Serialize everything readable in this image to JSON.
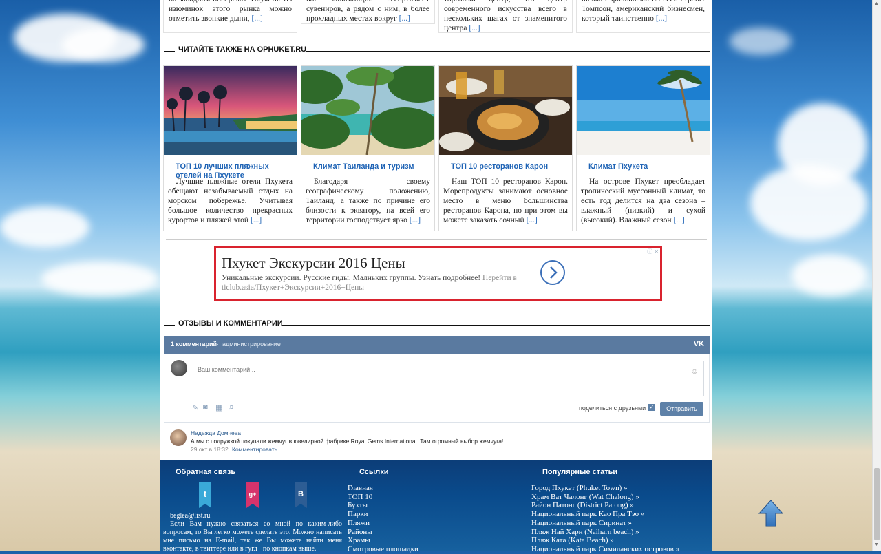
{
  "top_cards": [
    {
      "text": "на западном побережье Пхукета. Из изюминок этого рынка можно отметить звонкие дыни,",
      "more": "[...]"
    },
    {
      "text": "вне кальмбиции ассортимент сувениров, а рядом с ним, в более прохладных местах вокруг",
      "more": "[...]"
    },
    {
      "text": "торговый центр, это центр современного искусства всего в нескольких шагах от знаменитого центра",
      "more": "[...]"
    },
    {
      "text": "шелка с филиалами по всей стране. Томпсон, американский бизнесмен, который таинственно",
      "more": "[...]"
    }
  ],
  "read_also": {
    "heading": "ЧИТАЙТЕ ТАКЖЕ НА OPHUKET.RU",
    "cards": [
      {
        "title": "ТОП 10 лучших пляжных отелей на Пхукете",
        "text": "Лучшие пляжные отели Пхукета обещают незабываемый отдых на морском побережье. Учитывая большое количество прекрасных курортов и пляжей этой",
        "more": "[...]"
      },
      {
        "title": "Климат Таиланда и туризм",
        "text": "Благодаря своему географическому положению, Таиланд, а также по причине его близости к экватору, на всей его территории господствует ярко",
        "more": "[...]"
      },
      {
        "title": "ТОП 10 ресторанов Карон",
        "text": "Наш ТОП 10 ресторанов Карон. Морепродукты занимают основное место в меню большинства ресторанов Карона, но при этом вы можете заказать сочный",
        "more": "[...]"
      },
      {
        "title": "Климат Пхукета",
        "text": "На острове Пхукет преобладает тропический муссонный климат, то есть год делится на два сезона – влажный (низкий) и сухой (высокий). Влажный сезон",
        "more": "[...]"
      }
    ]
  },
  "ad": {
    "title": "Пхукет Экскурсии 2016 Цены",
    "text": "Уникальные экскурсии. Русские гиды. Малньких группы. Узнать подробнее!",
    "link": "Перейти в ticlub.asia/Пхукет+Экскурсии+2016+Цены"
  },
  "comments_section": {
    "heading": "ОТЗЫВЫ И КОММЕНТАРИИ",
    "count_label": "1 комментарий",
    "separator": "·",
    "admin_label": "администрирование",
    "vk_logo": "VK",
    "placeholder": "Ваш комментарий...",
    "share_label": "поделиться с друзьями",
    "send_label": "Отправить",
    "comment": {
      "author": "Надежда Домчева",
      "text": "А мы с подружкой покупали жемчуг в ювелирной фабрике Royal Gems International. Там огромный выбор жемчуга!",
      "date": "29 окт в 18:32",
      "reply_label": "Комментировать"
    }
  },
  "footer": {
    "feedback": {
      "heading": "Обратная связь",
      "email": "beglea@list.ru",
      "text": "Если Вам нужно связаться со мной по каким-либо вопросам, то Вы легко можете сделать это. Можно написать мне письмо на E-mail, так же Вы можете найти меня вконтакте, в твиттере или в гугл+ по кнопкам выше.",
      "socials": [
        {
          "icon": "twitter-icon",
          "glyph": "t",
          "color": "#3aa9d8"
        },
        {
          "icon": "google-plus-icon",
          "glyph": "g+",
          "color": "#d6336c"
        },
        {
          "icon": "vk-icon",
          "glyph": "B",
          "color": "#2d5d94"
        }
      ]
    },
    "links": {
      "heading": "Ссылки",
      "items": [
        "Главная",
        "ТОП 10",
        "Бухты",
        "Парки",
        "Пляжи",
        "Районы",
        "Храмы",
        "Смотровые площадки"
      ]
    },
    "popular": {
      "heading": "Популярные статьи",
      "items": [
        "Город Пхукет (Phuket Town) »",
        "Храм Ват Чалонг (Wat Chalong) »",
        "Район Патонг (District Patong) »",
        "Национальный парк Као Пра Тэо »",
        "Национальный парк Сиринат »",
        "Пляж Най Харн (Naiharn beach) »",
        "Пляж Ката (Kata Beach) »",
        "Национальный парк Симиланских островов »"
      ]
    }
  },
  "colors": {
    "link": "#1e63b5",
    "vk_header": "#5a7aa0",
    "ad_border": "#d9232e",
    "footer_bg": "#0a4b8c",
    "send_button": "#5e81a8"
  }
}
